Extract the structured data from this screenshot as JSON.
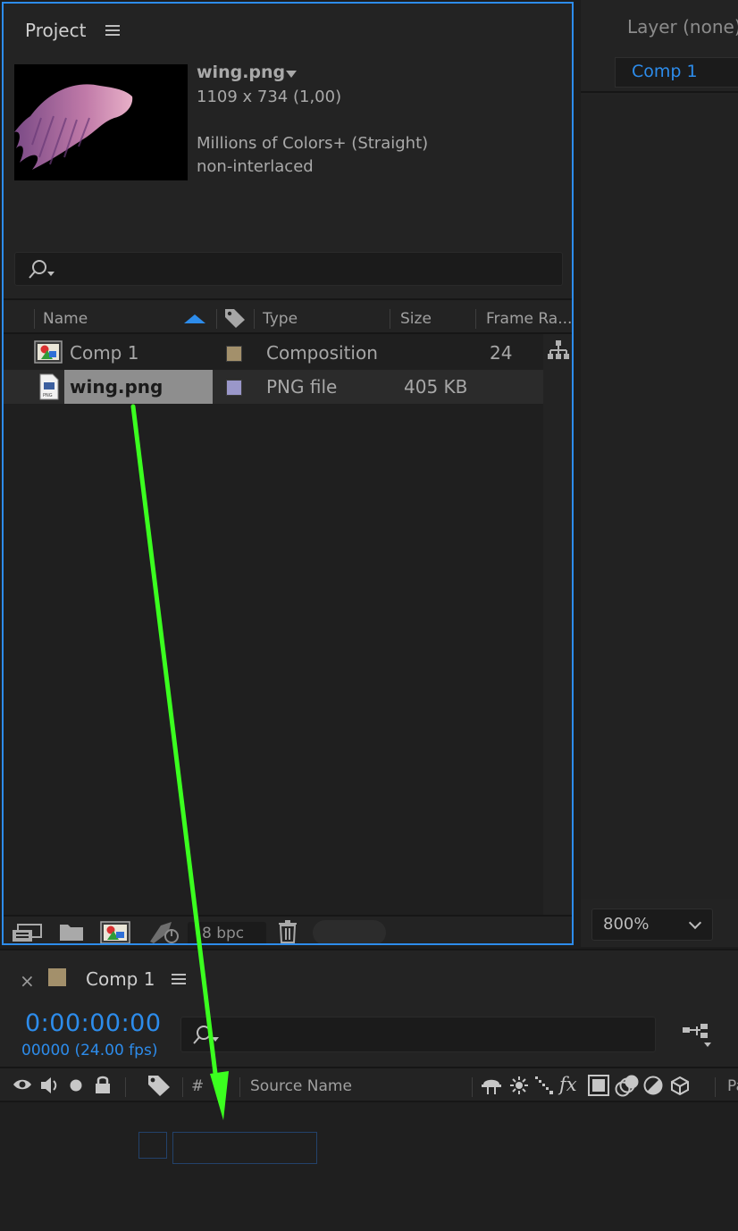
{
  "project_panel": {
    "tab_label": "Project",
    "preview": {
      "name": "wing.png",
      "dimensions": "1109 x 734 (1,00)",
      "colors": "Millions of Colors+ (Straight)",
      "interlace": "non-interlaced"
    },
    "columns": {
      "name": "Name",
      "type": "Type",
      "size": "Size",
      "frame_rate": "Frame Ra..."
    },
    "items": [
      {
        "name": "Comp 1",
        "type": "Composition",
        "size": "",
        "frame_rate": "24",
        "label_color": "#a3906b",
        "selected": false
      },
      {
        "name": "wing.png",
        "type": "PNG file",
        "size": "405 KB",
        "frame_rate": "",
        "label_color": "#9a97c9",
        "selected": true
      }
    ],
    "footer": {
      "bpc": "8 bpc"
    }
  },
  "layer_panel": {
    "title": "Layer (none)",
    "comp_tab": "Comp 1",
    "zoom": "800%"
  },
  "timeline": {
    "tab_label": "Comp 1",
    "close_glyph": "×",
    "timecode": "0:00:00:00",
    "frames_fps": "00000 (24.00 fps)",
    "columns": {
      "number": "#",
      "source_name": "Source Name",
      "parent_prefix": "Pa"
    }
  },
  "colors": {
    "accent": "#2d8ceb",
    "annotation_arrow": "#3bff1f",
    "comp_label": "#a3906b",
    "png_label": "#9a97c9"
  },
  "icons": [
    "hamburger-icon",
    "search-icon",
    "label-tag-icon",
    "composition-icon",
    "png-file-icon",
    "flowchart-icon",
    "interpret-footage-icon",
    "folder-icon",
    "new-composition-icon",
    "render-queue-icon",
    "trash-icon",
    "eye-icon",
    "audio-icon",
    "solo-icon",
    "lock-icon",
    "shy-icon",
    "collapse-icon",
    "quality-icon",
    "fx-icon",
    "frame-blend-icon",
    "motion-blur-icon",
    "adjustment-layer-icon",
    "3d-layer-icon"
  ]
}
